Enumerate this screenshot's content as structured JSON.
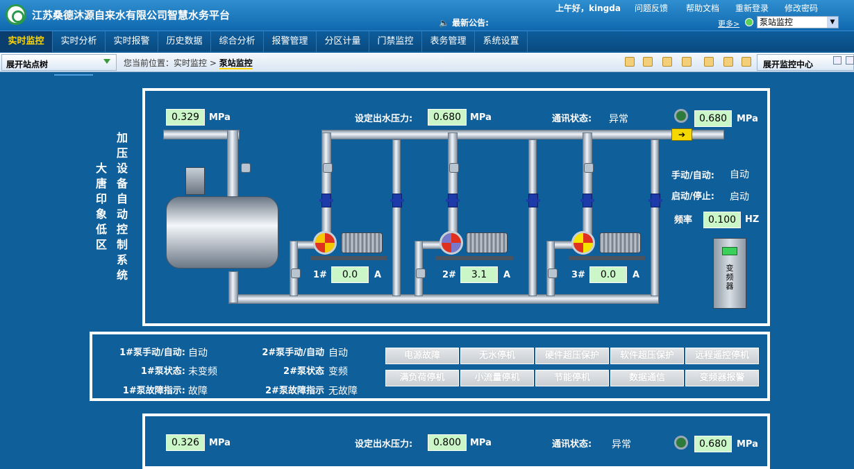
{
  "header": {
    "app_title": "江苏桑德沐源自来水有限公司智慧水务平台",
    "announcement_label": "最新公告:",
    "greeting": "上午好，kingda",
    "links": [
      "问题反馈",
      "帮助文档",
      "重新登录",
      "修改密码"
    ],
    "more_label": "更多>",
    "station_select_value": "泵站监控"
  },
  "menu": {
    "items": [
      "实时监控",
      "实时分析",
      "实时报警",
      "历史数据",
      "综合分析",
      "报警管理",
      "分区计量",
      "门禁监控",
      "表务管理",
      "系统设置"
    ],
    "active": "实时监控"
  },
  "toolbar": {
    "tree_toggle_label": "展开站点树",
    "crumb_prefix": "您当前位置：实时监控 >",
    "crumb_current": "泵站监控",
    "monitor_center_label": "展开监控中心"
  },
  "station": {
    "side_name": "大唐印象低区",
    "system_title": "加压设备自动控制系统",
    "inlet_pressure": "0.329",
    "pressure_unit": "MPa",
    "set_pressure_label": "设定出水压力:",
    "set_pressure": "0.680",
    "comm_status_label": "通讯状态:",
    "comm_status": "异常",
    "outlet_pressure": "0.680",
    "mode_label": "手动/自动:",
    "mode_value": "自动",
    "run_label": "启动/停止:",
    "run_value": "启动",
    "freq_label": "频率",
    "freq_value": "0.100",
    "freq_unit": "HZ",
    "vfd_label": "变频器",
    "current_unit": "A",
    "pumps": [
      {
        "label": "1#",
        "current": "0.0",
        "color": "#f5c800"
      },
      {
        "label": "2#",
        "current": "3.1",
        "color": "#7a78c8"
      },
      {
        "label": "3#",
        "current": "0.0",
        "color": "#f5e200"
      }
    ]
  },
  "status_panel": {
    "left_labels": [
      "1#泵手动/自动:",
      "1#泵状态:",
      "1#泵故障指示:"
    ],
    "left_values": [
      "自动",
      "未变频",
      "故障"
    ],
    "right_labels": [
      "2#泵手动/自动",
      "2#泵状态",
      "2#泵故障指示"
    ],
    "right_values": [
      "自动",
      "变频",
      "无故障"
    ],
    "alarm_buttons": [
      "电源故障",
      "无水停机",
      "硬件超压保护",
      "软件超压保护",
      "远程遥控停机",
      "满负荷停机",
      "小流量停机",
      "节能停机",
      "数据通信",
      "变频器报警"
    ]
  },
  "station2": {
    "inlet_pressure": "0.326",
    "pressure_unit": "MPa",
    "set_pressure_label": "设定出水压力:",
    "set_pressure": "0.800",
    "comm_status_label": "通讯状态:",
    "comm_status": "异常",
    "outlet_pressure": "0.680"
  }
}
